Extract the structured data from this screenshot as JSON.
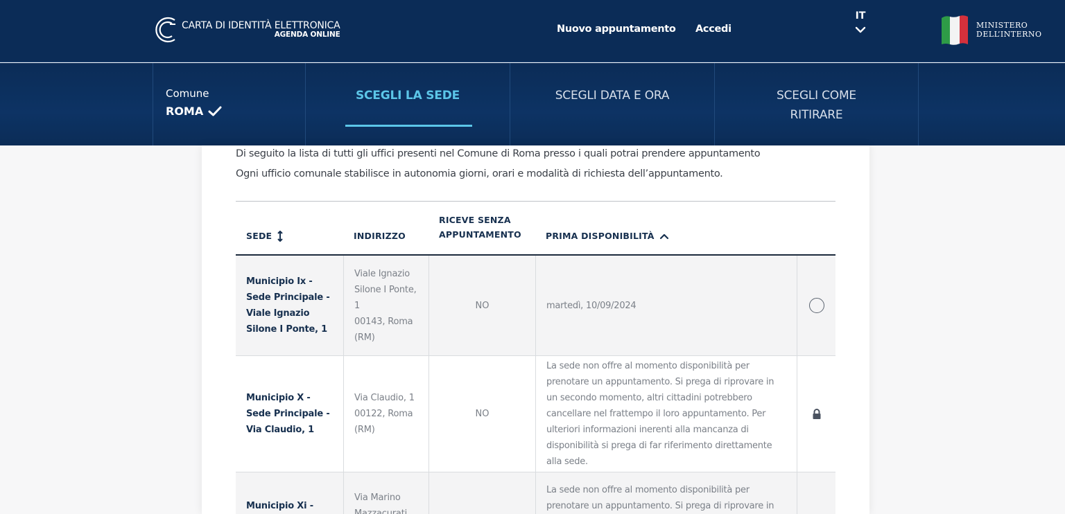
{
  "header": {
    "brand_title": "CARTA DI IDENTITÀ ELETTRONICA",
    "brand_subtitle": "AGENDA ONLINE",
    "nav_new_appointment": "Nuovo appuntamento",
    "nav_login": "Accedi",
    "language": "IT",
    "ministry_line1": "MINISTERO",
    "ministry_line2": "DELL’INTERNO"
  },
  "steps": {
    "comune_label": "Comune",
    "comune_value": "ROMA",
    "step_sede": "SCEGLI LA SEDE",
    "step_data": "SCEGLI DATA E ORA",
    "step_ritiro_line1": "SCEGLI COME",
    "step_ritiro_line2": "RITIRARE",
    "active": "step_sede"
  },
  "intro": {
    "line1": "Di seguito la lista di tutti gli uffici presenti nel Comune di Roma presso i quali potrai prendere appuntamento",
    "line2": "Ogni ufficio comunale stabilisce in autonomia giorni, orari e modalità di richiesta dell’appuntamento."
  },
  "table": {
    "headers": {
      "sede": "SEDE",
      "indirizzo": "INDIRIZZO",
      "senza_line1": "RICEVE SENZA",
      "senza_line2": "APPUNTAMENTO",
      "prima": "PRIMA DISPONIBILITÀ"
    },
    "rows": [
      {
        "sede": "Municipio Ix - Sede Principale - Viale Ignazio Silone I Ponte, 1",
        "addr1": "Viale Ignazio Silone I Ponte, 1",
        "addr2": "00143, Roma (RM)",
        "senza": "NO",
        "disponibilita": "martedì, 10/09/2024",
        "action": "radio"
      },
      {
        "sede": "Municipio X - Sede Principale - Via Claudio, 1",
        "addr1": "Via Claudio, 1",
        "addr2": "00122, Roma (RM)",
        "senza": "NO",
        "disponibilita": "La sede non offre al momento disponibilità per prenotare un appuntamento. Si prega di riprovare in un secondo momento, altri cittadini potrebbero cancellare nel frattempo il loro appuntamento. Per ulteriori informazioni inerenti alla mancanza di disponibilità si prega di far riferimento direttamente alla sede.",
        "action": "lock"
      },
      {
        "sede": "Municipio Xi -",
        "addr1": "Via Marino Mazzacurati",
        "senza": "",
        "disponibilita": "La sede non offre al momento disponibilità per prenotare un appuntamento. Si prega di riprovare in un"
      }
    ]
  },
  "colors": {
    "header_bg": "#0b2c57",
    "accent": "#5cc6e8",
    "heading_text": "#17304f",
    "muted_text": "#7b8088"
  }
}
